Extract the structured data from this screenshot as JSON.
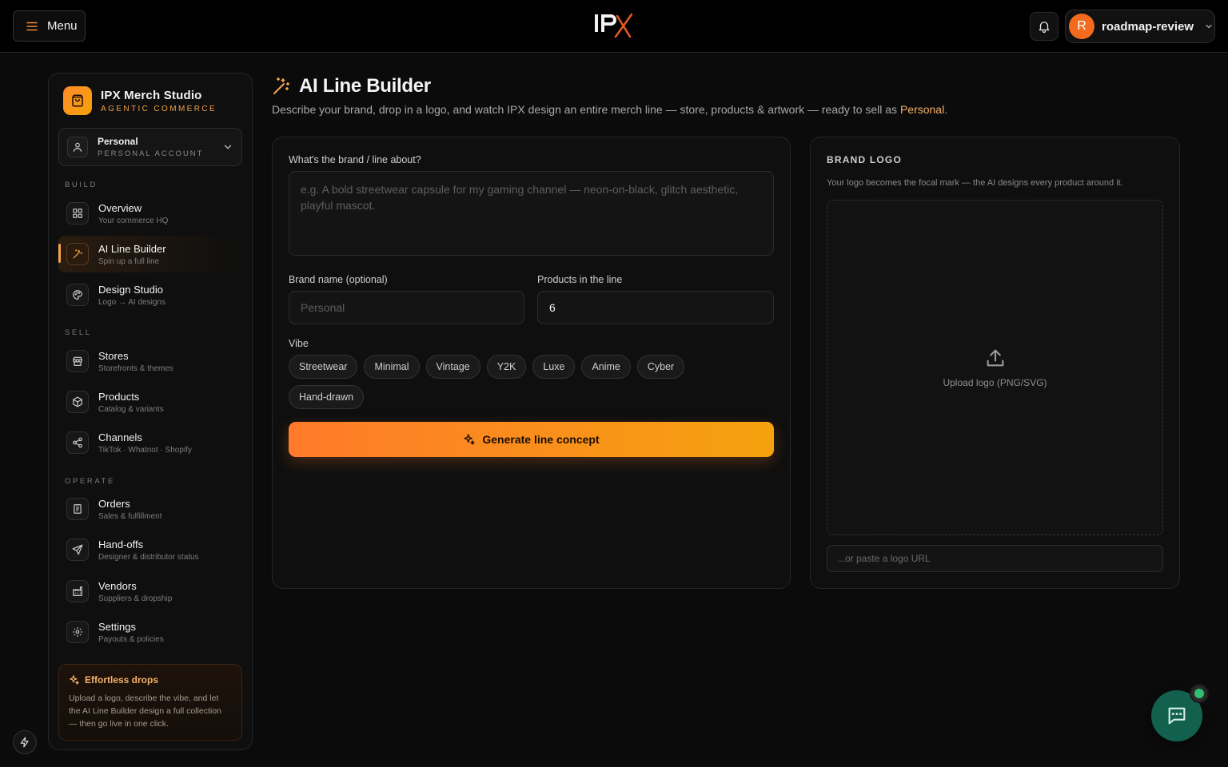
{
  "topbar": {
    "menu_label": "Menu",
    "user": {
      "initial": "R",
      "name": "roadmap-review"
    }
  },
  "sidebar": {
    "brand": {
      "title": "IPX Merch Studio",
      "subtitle": "AGENTIC COMMERCE"
    },
    "account": {
      "name": "Personal",
      "type": "PERSONAL ACCOUNT"
    },
    "sections": {
      "build": "BUILD",
      "sell": "SELL",
      "operate": "OPERATE"
    },
    "items": [
      {
        "label": "Overview",
        "sub": "Your commerce HQ",
        "icon": "grid-icon"
      },
      {
        "label": "AI Line Builder",
        "sub": "Spin up a full line",
        "icon": "magic-wand-icon",
        "active": true
      },
      {
        "label": "Design Studio",
        "sub": "Logo → AI designs",
        "icon": "palette-icon"
      },
      {
        "label": "Stores",
        "sub": "Storefronts & themes",
        "icon": "store-icon"
      },
      {
        "label": "Products",
        "sub": "Catalog & variants",
        "icon": "package-icon"
      },
      {
        "label": "Channels",
        "sub": "TikTok · Whatnot · Shopify",
        "icon": "share-icon"
      },
      {
        "label": "Orders",
        "sub": "Sales & fulfillment",
        "icon": "receipt-icon"
      },
      {
        "label": "Hand-offs",
        "sub": "Designer & distributor status",
        "icon": "send-icon"
      },
      {
        "label": "Vendors",
        "sub": "Suppliers & dropship",
        "icon": "factory-icon"
      },
      {
        "label": "Settings",
        "sub": "Payouts & policies",
        "icon": "gear-icon"
      }
    ],
    "promo": {
      "title": "Effortless drops",
      "text": "Upload a logo, describe the vibe, and let the AI Line Builder design a full collection — then go live in one click."
    }
  },
  "main": {
    "title": "AI Line Builder",
    "description": "Describe your brand, drop in a logo, and watch IPX design an entire merch line — store, products & artwork — ready to sell as ",
    "description_highlight": "Personal",
    "description_end": ".",
    "form": {
      "about_label": "What's the brand / line about?",
      "about_placeholder": "e.g. A bold streetwear capsule for my gaming channel — neon-on-black, glitch aesthetic, playful mascot.",
      "brand_label": "Brand name (optional)",
      "brand_placeholder": "Personal",
      "products_label": "Products in the line",
      "products_value": "6",
      "vibe_label": "Vibe",
      "vibes": [
        "Streetwear",
        "Minimal",
        "Vintage",
        "Y2K",
        "Luxe",
        "Anime",
        "Cyber",
        "Hand-drawn"
      ],
      "generate_label": "Generate line concept"
    },
    "logo_card": {
      "title": "BRAND LOGO",
      "description": "Your logo becomes the focal mark — the AI designs every product around it.",
      "upload_label": "Upload logo (PNG/SVG)",
      "url_placeholder": "...or paste a logo URL"
    }
  },
  "colors": {
    "accent": "#f5a24a",
    "accent_gradient_start": "#ff7a2a",
    "accent_gradient_end": "#f5a20e",
    "chat_bg": "#12614e",
    "status_online": "#2fbf71"
  }
}
